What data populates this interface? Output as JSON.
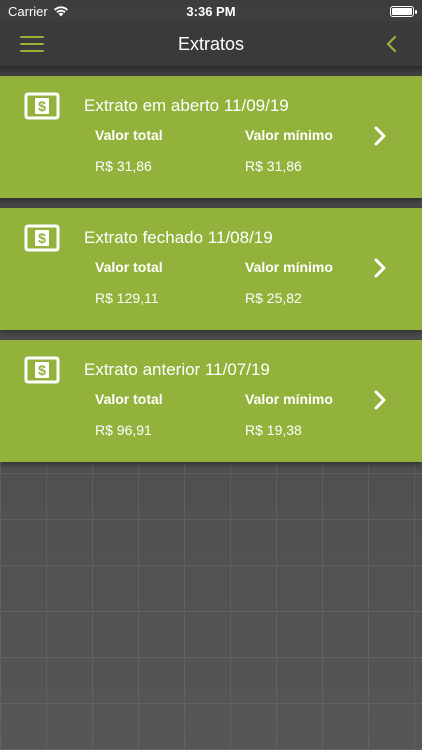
{
  "status": {
    "carrier": "Carrier",
    "time": "3:36 PM"
  },
  "nav": {
    "title": "Extratos"
  },
  "cards": [
    {
      "title": "Extrato em aberto 11/09/19",
      "total_label": "Valor total",
      "total_value": "R$ 31,86",
      "min_label": "Valor mínimo",
      "min_value": "R$ 31,86"
    },
    {
      "title": "Extrato fechado 11/08/19",
      "total_label": "Valor total",
      "total_value": "R$ 129,11",
      "min_label": "Valor mínimo",
      "min_value": "R$ 25,82"
    },
    {
      "title": "Extrato anterior 11/07/19",
      "total_label": "Valor total",
      "total_value": "R$ 96,91",
      "min_label": "Valor mínimo",
      "min_value": "R$ 19,38"
    }
  ],
  "colors": {
    "accent": "#93b23b",
    "nav_icon": "#9bb23a",
    "background": "#4a4a4a"
  },
  "icons": {
    "menu": "hamburger-icon",
    "back": "chevron-left-icon",
    "card": "dollar-bill-icon",
    "card_arrow": "chevron-right-icon"
  }
}
